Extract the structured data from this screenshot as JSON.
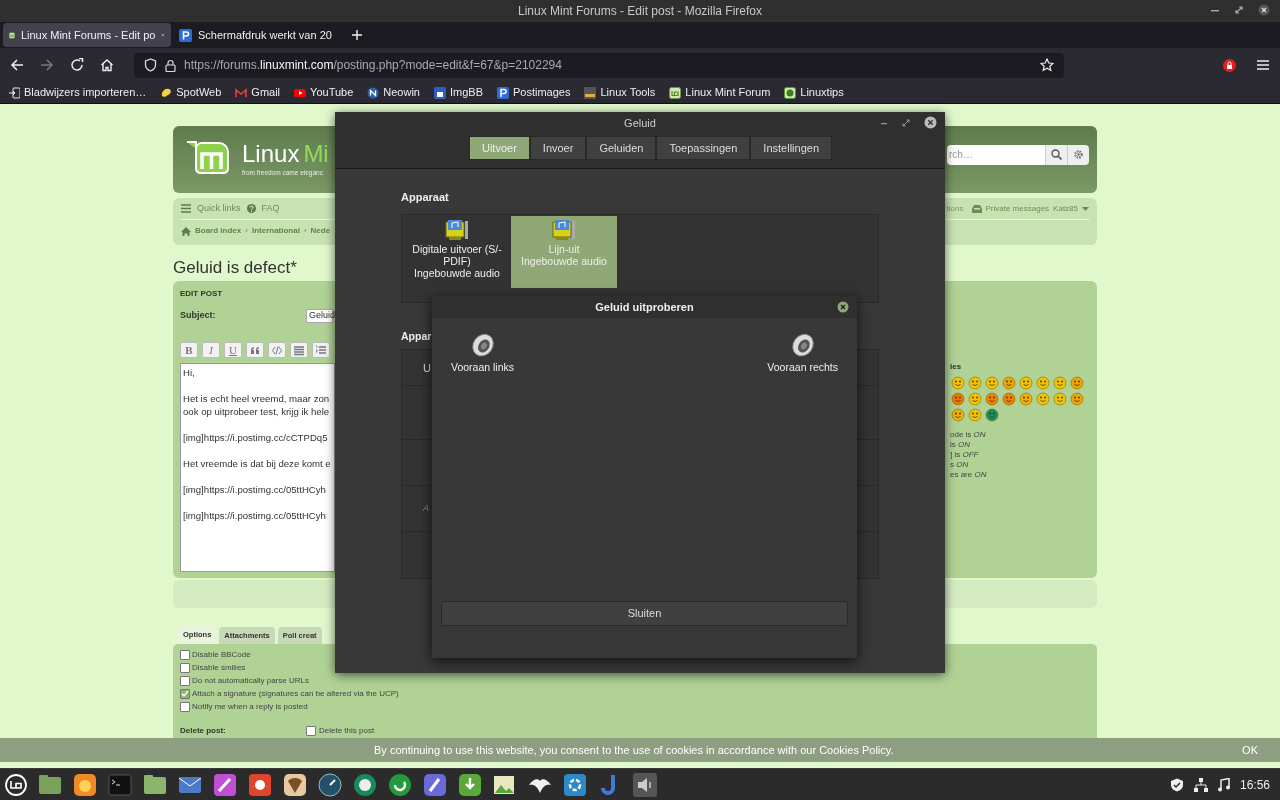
{
  "window": {
    "title": "Linux Mint Forums - Edit post - Mozilla Firefox"
  },
  "browser": {
    "tabs": [
      {
        "title": "Linux Mint Forums - Edit po",
        "selected": true
      },
      {
        "title": "Schermafdruk werkt van 20",
        "selected": false
      }
    ],
    "url": {
      "prefix": "https://forums.",
      "domain": "linuxmint.com",
      "path": "/posting.php?mode=edit&f=67&p=2102294"
    },
    "bookmarks": [
      "Bladwijzers importeren…",
      "SpotWeb",
      "Gmail",
      "YouTube",
      "Neowin",
      "ImgBB",
      "Postimages",
      "Linux Tools",
      "Linux Mint Forum",
      "Linuxtips"
    ]
  },
  "forum": {
    "logo": {
      "word": "Linux",
      "accent": "Mi",
      "tagline": "from freedom came eleganc"
    },
    "search": {
      "placeholder": "rch…"
    },
    "nav": {
      "links": [
        "Quick links",
        "FAQ"
      ],
      "user_links": [
        "tions",
        "Private messages",
        "Katz85"
      ],
      "breadcrumbs": [
        "Board index",
        "International",
        "Nede"
      ],
      "breadcrumb_separator": "‹"
    },
    "title": "Geluid is defect*",
    "edit_post": {
      "heading": "EDIT POST",
      "subject_label": "Subject:",
      "subject_value": "Geluid",
      "format_buttons": [
        "B",
        "I",
        "U"
      ],
      "message_paragraphs": [
        [
          "Hi,"
        ],
        [
          "Het is echt heel vreemd, maar zon",
          "ook op uitprobeer test, krijg ik hele"
        ],
        [
          "[img]https://i.postimg.cc/cCTPDq5"
        ],
        [
          "Het vreemde is dat bij deze komt e"
        ],
        [
          "[img]https://i.postimg.cc/05ttHCyh"
        ],
        [
          "[img]https://i.postimg.cc/05ttHCyh"
        ]
      ],
      "smilies_heading": "ies",
      "bbcode_status": [
        "ode is *ON*",
        "is *ON*",
        "] is *OFF*",
        "s *ON*",
        "es are *ON*"
      ]
    },
    "option_tabs": [
      {
        "label": "Options",
        "selected": true
      },
      {
        "label": "Attachments",
        "selected": false
      },
      {
        "label": "Poll creat",
        "selected": false
      }
    ],
    "options": [
      {
        "label": "Disable BBCode",
        "checked": false
      },
      {
        "label": "Disable smilies",
        "checked": false
      },
      {
        "label": "Do not automatically parse URLs",
        "checked": false
      },
      {
        "label": "Attach a signature (signatures can be altered via the UCP)",
        "checked": true
      },
      {
        "label": "Notify me when a reply is posted",
        "checked": false
      }
    ],
    "delete_post": {
      "label": "Delete post:",
      "option": "Delete this post",
      "checked": false
    }
  },
  "cookie_bar": {
    "text": "By continuing to use this website, you consent to the use of cookies in accordance with our Cookies Policy.",
    "button": "OK"
  },
  "taskbar": {
    "time": "16:56"
  },
  "sound_window": {
    "title": "Geluid",
    "tabs": [
      {
        "label": "Uitvoer",
        "selected": true
      },
      {
        "label": "Invoer",
        "selected": false
      },
      {
        "label": "Geluiden",
        "selected": false
      },
      {
        "label": "Toepassingen",
        "selected": false
      },
      {
        "label": "Instellingen",
        "selected": false
      }
    ],
    "device_heading": "Apparaat",
    "devices": [
      {
        "name": "Digitale uitvoer (S/-PDIF)",
        "subtitle": "Ingebouwde audio",
        "selected": false
      },
      {
        "name": "Lijn-uit",
        "subtitle": "Ingebouwde audio",
        "selected": true
      }
    ],
    "second_heading": "Appar",
    "row_fragments": [
      "U",
      "A"
    ]
  },
  "test_dialog": {
    "title": "Geluid uitproberen",
    "speakers": [
      "Vooraan links",
      "Vooraan rechts"
    ],
    "button": "Sluiten"
  }
}
